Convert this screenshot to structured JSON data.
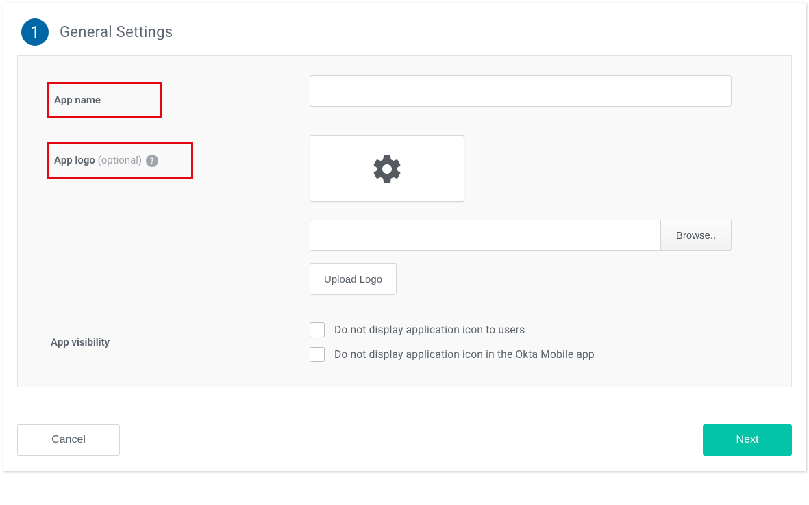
{
  "step": {
    "number": "1",
    "title": "General Settings"
  },
  "fields": {
    "app_name": {
      "label": "App name",
      "value": ""
    },
    "app_logo": {
      "label": "App logo",
      "optional_text": "(optional)",
      "help_glyph": "?",
      "file_value": "",
      "browse_label": "Browse..",
      "upload_label": "Upload Logo",
      "icon_name": "gear-icon"
    },
    "app_visibility": {
      "label": "App visibility",
      "options": [
        "Do not display application icon to users",
        "Do not display application icon in the Okta Mobile app"
      ]
    }
  },
  "footer": {
    "cancel": "Cancel",
    "next": "Next"
  },
  "colors": {
    "accent": "#05c3a7",
    "step_badge": "#0067a6",
    "highlight": "#e30613"
  }
}
